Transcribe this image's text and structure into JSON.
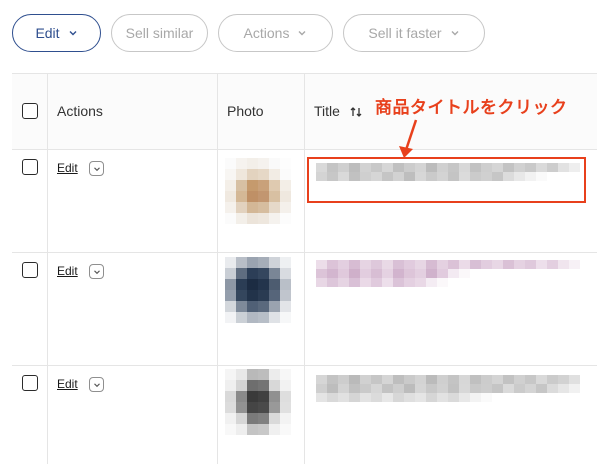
{
  "toolbar": {
    "edit_label": "Edit",
    "sell_similar_label": "Sell similar",
    "actions_label": "Actions",
    "sell_faster_label": "Sell it faster"
  },
  "table": {
    "columns": [
      "Actions",
      "Photo",
      "Title"
    ],
    "rows": [
      {
        "edit_label": "Edit"
      },
      {
        "edit_label": "Edit"
      },
      {
        "edit_label": "Edit"
      }
    ]
  },
  "annotation": {
    "label": "商品タイトルをクリック",
    "color": "#e8401c"
  },
  "colors": {
    "accent": "#2f4f8f",
    "annotation": "#e8401c",
    "border": "#e5e5e5"
  }
}
